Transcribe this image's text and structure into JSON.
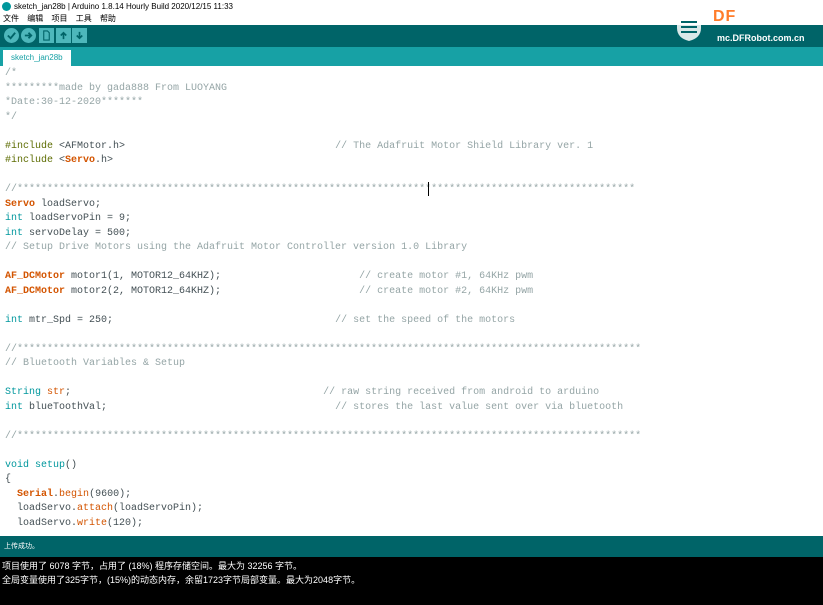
{
  "window": {
    "title": "sketch_jan28b | Arduino 1.8.14 Hourly Build 2020/12/15 11:33"
  },
  "menu": {
    "items": [
      "文件",
      "编辑",
      "项目",
      "工具",
      "帮助"
    ]
  },
  "tab": {
    "label": "sketch_jan28b"
  },
  "watermark": {
    "brand": "DF",
    "url": "mc.DFRobot.com.cn"
  },
  "code": {
    "lines": [
      [
        {
          "t": "/*",
          "c": "cmt"
        }
      ],
      [
        {
          "t": "*********made by gada888 From LUOYANG",
          "c": "cmt"
        }
      ],
      [
        {
          "t": "*Date:30-12-2020*******",
          "c": "cmt"
        }
      ],
      [
        {
          "t": "*/",
          "c": "cmt"
        }
      ],
      [],
      [
        {
          "t": "#include ",
          "c": "pp"
        },
        {
          "t": "<AFMotor.h>",
          "c": ""
        },
        {
          "t": "                                   // The Adafruit Motor Shield Library ver. 1",
          "c": "cmt"
        }
      ],
      [
        {
          "t": "#include ",
          "c": "pp"
        },
        {
          "t": "<",
          "c": ""
        },
        {
          "t": "Servo",
          "c": "ty"
        },
        {
          "t": ".h>",
          "c": ""
        }
      ],
      [],
      [
        {
          "t": "//*******************************************************************************************************",
          "c": "cmt"
        }
      ],
      [
        {
          "t": "Servo",
          "c": "ty"
        },
        {
          "t": " loadServo;",
          "c": ""
        }
      ],
      [
        {
          "t": "int",
          "c": "kw"
        },
        {
          "t": " loadServoPin = 9;",
          "c": ""
        }
      ],
      [
        {
          "t": "int",
          "c": "kw"
        },
        {
          "t": " servoDelay = 500;",
          "c": ""
        }
      ],
      [
        {
          "t": "// Setup Drive Motors using the Adafruit Motor Controller version 1.0 Library",
          "c": "cmt"
        }
      ],
      [],
      [
        {
          "t": "AF_DCMotor",
          "c": "ty"
        },
        {
          "t": " motor1(1, MOTOR12_64KHZ);",
          "c": ""
        },
        {
          "t": "                       // create motor #1, 64KHz pwm",
          "c": "cmt"
        }
      ],
      [
        {
          "t": "AF_DCMotor",
          "c": "ty"
        },
        {
          "t": " motor2(2, MOTOR12_64KHZ);",
          "c": ""
        },
        {
          "t": "                       // create motor #2, 64KHz pwm",
          "c": "cmt"
        }
      ],
      [],
      [
        {
          "t": "int",
          "c": "kw"
        },
        {
          "t": " mtr_Spd = 250;",
          "c": ""
        },
        {
          "t": "                                     // set the speed of the motors",
          "c": "cmt"
        }
      ],
      [],
      [
        {
          "t": "//********************************************************************************************************",
          "c": "cmt"
        }
      ],
      [
        {
          "t": "// Bluetooth Variables & Setup",
          "c": "cmt"
        }
      ],
      [],
      [
        {
          "t": "String",
          "c": "kw"
        },
        {
          "t": " ",
          "c": ""
        },
        {
          "t": "str",
          "c": "fn"
        },
        {
          "t": ";",
          "c": ""
        },
        {
          "t": "                                          // raw string received from android to arduino",
          "c": "cmt"
        }
      ],
      [
        {
          "t": "int",
          "c": "kw"
        },
        {
          "t": " blueToothVal;",
          "c": ""
        },
        {
          "t": "                                      // stores the last value sent over via bluetooth",
          "c": "cmt"
        }
      ],
      [],
      [
        {
          "t": "//********************************************************************************************************",
          "c": "cmt"
        }
      ],
      [],
      [
        {
          "t": "void",
          "c": "kw"
        },
        {
          "t": " ",
          "c": ""
        },
        {
          "t": "setup",
          "c": "kw"
        },
        {
          "t": "()",
          "c": ""
        }
      ],
      [
        {
          "t": "{",
          "c": ""
        }
      ],
      [
        {
          "t": "  ",
          "c": ""
        },
        {
          "t": "Serial",
          "c": "ty"
        },
        {
          "t": ".",
          "c": ""
        },
        {
          "t": "begin",
          "c": "fn"
        },
        {
          "t": "(9600);",
          "c": ""
        }
      ],
      [
        {
          "t": "  loadServo.",
          "c": ""
        },
        {
          "t": "attach",
          "c": "fn"
        },
        {
          "t": "(loadServoPin);",
          "c": ""
        }
      ],
      [
        {
          "t": "  loadServo.",
          "c": ""
        },
        {
          "t": "write",
          "c": "fn"
        },
        {
          "t": "(120);",
          "c": ""
        }
      ]
    ]
  },
  "status": {
    "text": "上传成功。"
  },
  "console": {
    "line1": "项目使用了 6078 字节，占用了 (18%) 程序存储空间。最大为 32256 字节。",
    "line2": "全局变量使用了325字节，(15%)的动态内存，余留1723字节局部变量。最大为2048字节。"
  },
  "colors": {
    "toolbar": "#006468",
    "tabbar": "#17a1a5",
    "button": "#4db7bb",
    "brand": "#ff7c2a"
  },
  "toolbar": {
    "buttons": [
      "verify-icon",
      "upload-icon",
      "new-icon",
      "open-icon",
      "save-icon"
    ]
  }
}
